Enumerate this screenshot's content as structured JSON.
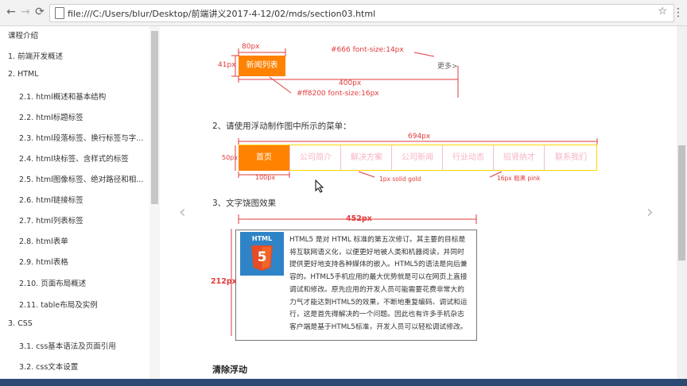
{
  "browser": {
    "url": "file:///C:/Users/blur/Desktop/前端讲义2017-4-12/02/mds/section03.html",
    "back_icon": "arrow-left-icon",
    "forward_icon": "arrow-right-icon",
    "reload_icon": "reload-icon",
    "bookmark_icon": "star-icon"
  },
  "sidebar": {
    "title": "课程介绍",
    "items": [
      {
        "label": "1. 前端开发概述"
      },
      {
        "label": "2. HTML"
      },
      {
        "label": "2.1. html概述和基本结构"
      },
      {
        "label": "2.2. html标题标签"
      },
      {
        "label": "2.3. html段落标签、换行标签与字..."
      },
      {
        "label": "2.4. html块标签、含样式的标签"
      },
      {
        "label": "2.5. html图像标签、绝对路径和相..."
      },
      {
        "label": "2.6. html链接标签"
      },
      {
        "label": "2.7. html列表标签"
      },
      {
        "label": "2.8. html表单"
      },
      {
        "label": "2.9. html表格"
      },
      {
        "label": "2.10. 页面布局概述"
      },
      {
        "label": "2.11. table布局及实例"
      },
      {
        "label": "3. CSS"
      },
      {
        "label": "3.1. css基本语法及页面引用"
      },
      {
        "label": "3.2. css文本设置"
      }
    ]
  },
  "figure1": {
    "width_label": "80px",
    "height_label": "41px",
    "box_text": "新闻列表",
    "style_note": "#666  font-size:14px",
    "more_link": "更多>",
    "line_width_label": "400px",
    "box_style_note": "#ff8200  font-size:16px",
    "accent_color": "#ff8200"
  },
  "section2": {
    "title": "2、请使用浮动制作图中所示的菜单：",
    "total_width_label": "694px",
    "height_label": "50px",
    "item_width_label": "100px",
    "border_note": "1px solid gold",
    "text_note": "16px 粗黑 pink",
    "menu_items": [
      "首页",
      "公司简介",
      "解决方案",
      "公司新闻",
      "行业动态",
      "招贤纳才",
      "联系我们"
    ]
  },
  "section3": {
    "title": "3、文字饶图效果",
    "width_label": "452px",
    "height_label": "212px",
    "logo_text": "HTML",
    "logo_number": "5",
    "paragraph": "HTML5 是对 HTML 标准的第五次修订。其主要的目标是将互联网语义化，以便更好地被人类和机器阅读，并同时提供更好地支持各种媒体的嵌入。HTML5的语法是向后兼容的。HTML5手机应用的最大优势就是可以在网页上直接调试和修改。原先应用的开发人员可能需要花费非常大的力气才能达到HTML5的效果，不断地重复编码、调试和运行，这是首先得解决的一个问题。因此也有许多手机杂志客户端是基于HTML5标准，开发人员可以轻松调试修改。"
  },
  "section4": {
    "title": "清除浮动"
  }
}
